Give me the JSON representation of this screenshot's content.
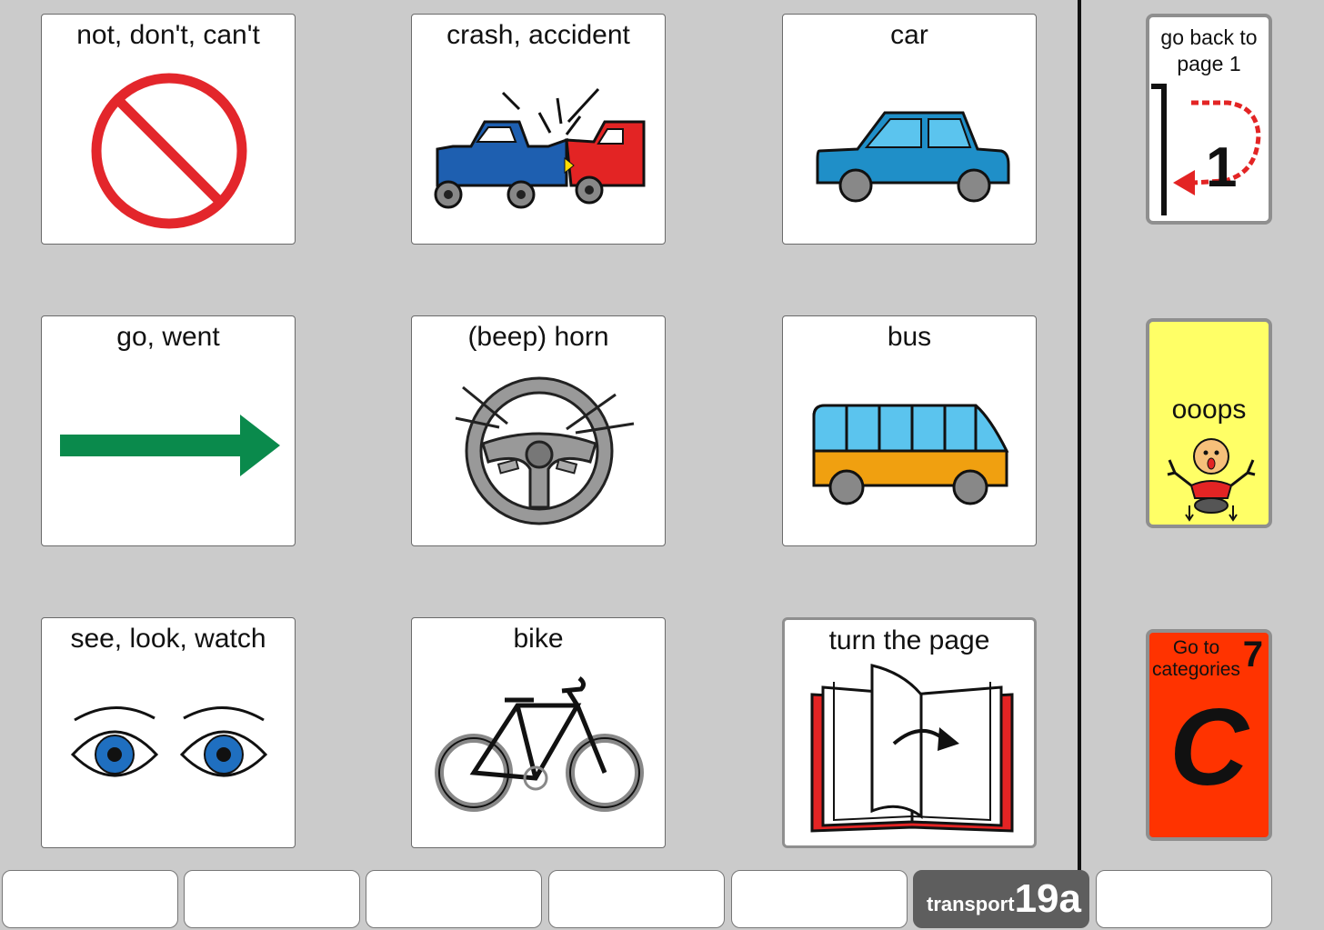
{
  "grid": [
    {
      "label": "not, don't, can't",
      "icon": "no-sign-icon"
    },
    {
      "label": "crash,  accident",
      "icon": "car-crash-icon"
    },
    {
      "label": "car",
      "icon": "car-icon"
    },
    {
      "label": "go,  went",
      "icon": "right-arrow-icon"
    },
    {
      "label": "(beep) horn",
      "icon": "steering-wheel-icon"
    },
    {
      "label": "bus",
      "icon": "bus-icon"
    },
    {
      "label": "see, look, watch",
      "icon": "eyes-icon"
    },
    {
      "label": "bike",
      "icon": "bicycle-icon"
    },
    {
      "label": "turn the page",
      "icon": "open-book-icon"
    }
  ],
  "side": {
    "back": {
      "label_line1": "go back to",
      "label_line2": "page 1",
      "number": "1"
    },
    "oops": {
      "label": "ooops"
    },
    "categories": {
      "label_line1": "Go to",
      "label_line2": "categories",
      "number": "7",
      "letter": "C"
    }
  },
  "bottom_bar": {
    "active_tab": {
      "name": "transport",
      "page": "19a"
    }
  },
  "colors": {
    "background": "#cbcbcb",
    "oops_yellow": "#ffff66",
    "categories_orange": "#ff3300",
    "arrow_green": "#0a8a4c",
    "car_blue": "#1f8fc8",
    "no_sign_red": "#e3262b"
  }
}
